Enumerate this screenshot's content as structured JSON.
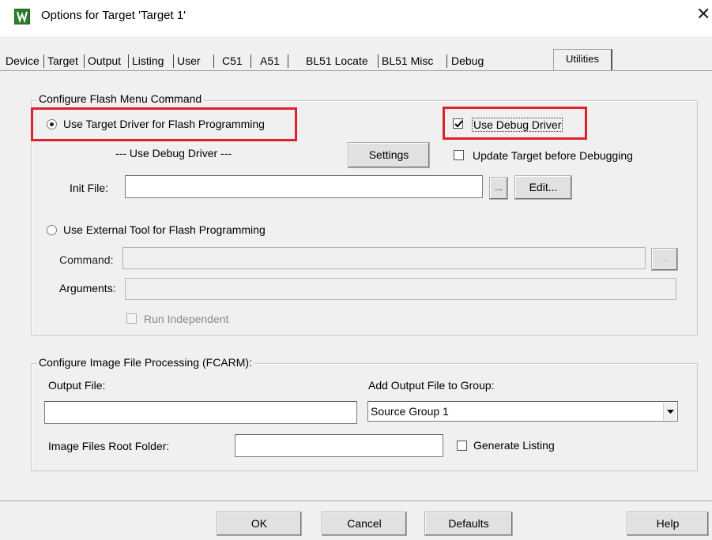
{
  "window": {
    "title": "Options for Target 'Target 1'",
    "close": "✕"
  },
  "tabs": [
    {
      "label": "Device"
    },
    {
      "label": "Target"
    },
    {
      "label": "Output"
    },
    {
      "label": "Listing"
    },
    {
      "label": "User"
    },
    {
      "label": "C51"
    },
    {
      "label": "A51"
    },
    {
      "label": "BL51 Locate"
    },
    {
      "label": "BL51 Misc"
    },
    {
      "label": "Debug"
    },
    {
      "label": "Utilities"
    }
  ],
  "active_tab": "Utilities",
  "flash": {
    "group_title": "Configure Flash Menu Command",
    "use_target_driver_label": "Use Target Driver for Flash Programming",
    "use_target_driver_selected": true,
    "use_debug_driver_label": "Use Debug Driver",
    "use_debug_driver_checked": true,
    "driver_label": "--- Use Debug Driver ---",
    "settings_button": "Settings",
    "update_target_label": "Update Target before Debugging",
    "update_target_checked": false,
    "init_file_label": "Init File:",
    "init_file_value": "",
    "browse_button": "...",
    "edit_button": "Edit...",
    "use_external_label": "Use External Tool for Flash Programming",
    "use_external_selected": false,
    "command_label": "Command:",
    "command_value": "",
    "command_browse": "...",
    "arguments_label": "Arguments:",
    "arguments_value": "",
    "run_independent_label": "Run Independent",
    "run_independent_checked": false
  },
  "image": {
    "group_title": "Configure Image File Processing (FCARM):",
    "output_file_label": "Output File:",
    "output_file_value": "",
    "add_output_label": "Add Output File  to Group:",
    "group_select_value": "Source Group 1",
    "root_folder_label": "Image Files Root Folder:",
    "root_folder_value": "",
    "generate_listing_label": "Generate Listing",
    "generate_listing_checked": false
  },
  "footer": {
    "ok": "OK",
    "cancel": "Cancel",
    "defaults": "Defaults",
    "help": "Help"
  },
  "colors": {
    "highlight_box": "#e0202a",
    "dialog_bg": "#f0f0f0",
    "app_icon": "#2e7d32"
  }
}
